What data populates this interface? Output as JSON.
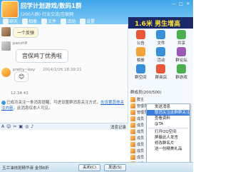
{
  "window": {
    "title": "回学计划游戏/数码1群",
    "subtitle": "(200人群) 行业交流/互联网",
    "controls": [
      "—",
      "□",
      "✕"
    ]
  },
  "toolbar": {
    "items": [
      {
        "label": "聊天",
        "icon": "chat-icon"
      },
      {
        "label": "相册",
        "icon": "album-icon"
      },
      {
        "label": "文件",
        "icon": "file-icon"
      },
      {
        "label": "活动",
        "icon": "activity-icon"
      },
      {
        "label": "设置",
        "icon": "settings-icon"
      }
    ]
  },
  "ad": {
    "text": "1.6米 男生增高"
  },
  "chat": {
    "messages": [
      {
        "text": "一个反弹"
      },
      {
        "sender": "panzh8",
        "text": "宫保鸡丁优秀啦"
      },
      {
        "sender": "pretty~boy",
        "timestamp": "2014/2/26 18:39:21",
        "text": "😊"
      }
    ],
    "time": "12:34:43",
    "system_notice": "已成功关注一条消息提醒，可进设置群消息关注方式，",
    "system_link": "去设置其他关注内容",
    "system_tail": "，此消息仅本人可见。"
  },
  "input_toolbar": {
    "icons": [
      "font-icon",
      "emoji-icon",
      "screenshot-icon",
      "image-icon",
      "shake-icon",
      "voice-icon"
    ],
    "message_record": "消息记录"
  },
  "status": {
    "text": "玉兰油祛斑精华液 金领6折"
  },
  "buttons": {
    "close": "关闭(C)",
    "send": "发送(S)"
  },
  "apps": [
    {
      "label": "公告",
      "color": "#e8583a"
    },
    {
      "label": "文件",
      "color": "#3a8fd8"
    },
    {
      "label": "共享",
      "color": "#4caf50"
    },
    {
      "label": "相册",
      "color": "#f2a33a"
    },
    {
      "label": "活动",
      "color": "#3a8fd8"
    },
    {
      "label": "群论坛",
      "color": "#9b59b6"
    },
    {
      "label": "群空间",
      "color": "#3a8fd8"
    },
    {
      "label": "群商店",
      "color": "#e8583a"
    },
    {
      "label": "群游戏",
      "color": "#4caf50"
    }
  ],
  "members": {
    "header": "群成员(200/500)",
    "items": [
      "群主",
      "管理员",
      "管理员",
      "成员",
      "成员",
      "成员",
      "成员",
      "成员",
      "成员",
      "成员",
      "成员",
      "成员"
    ]
  },
  "context_menu": {
    "items": [
      "发送消息",
      "取消关注此群群关注",
      "查看资料",
      "@TA",
      "打开QQ空间",
      "屏蔽此人发言",
      "修改群名片",
      "送一份精美礼品"
    ],
    "highlighted_index": 1
  }
}
